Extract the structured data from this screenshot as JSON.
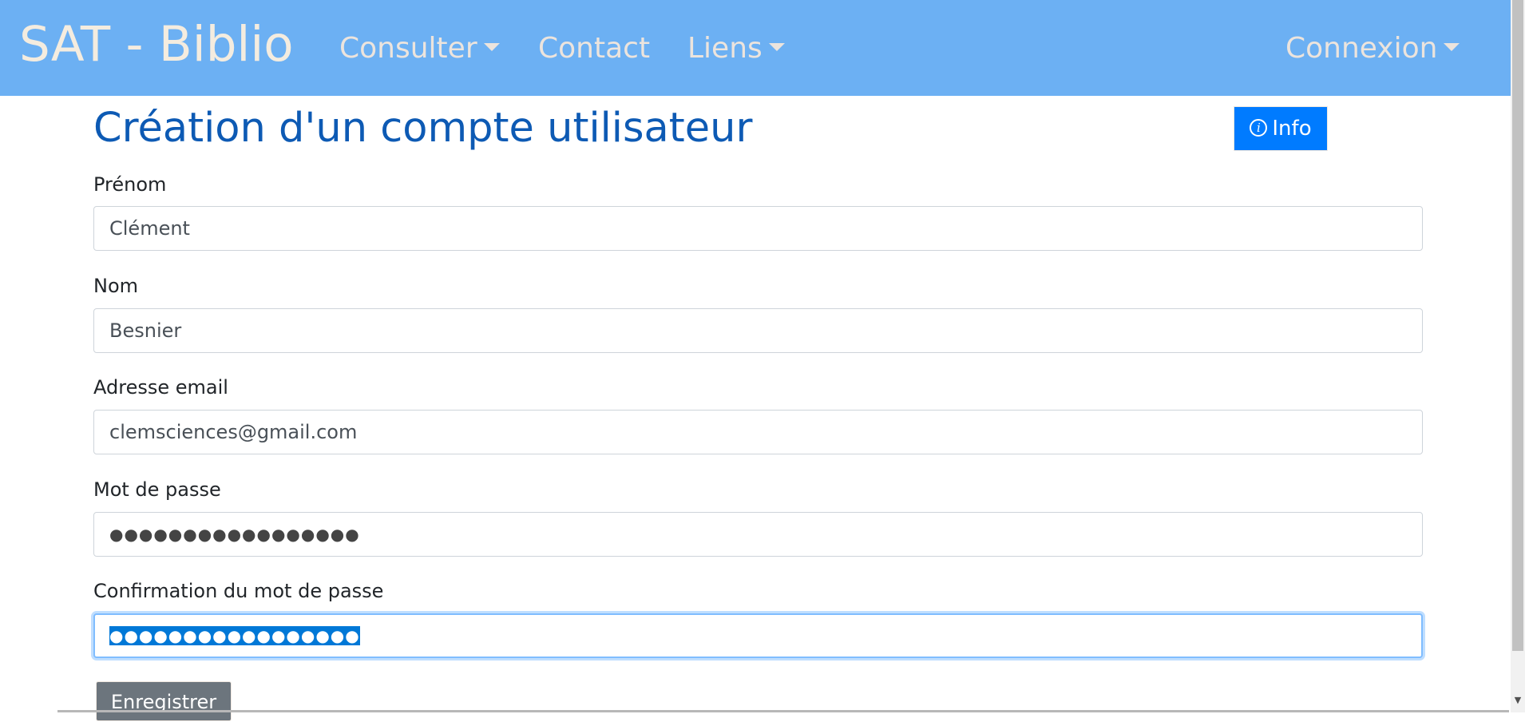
{
  "navbar": {
    "brand": "SAT - Biblio",
    "items": [
      {
        "label": "Consulter",
        "dropdown": true
      },
      {
        "label": "Contact",
        "dropdown": false
      },
      {
        "label": "Liens",
        "dropdown": true
      }
    ],
    "login": {
      "label": "Connexion",
      "dropdown": true
    }
  },
  "form": {
    "title": "Création d'un compte utilisateur",
    "info_button": {
      "label": "Info",
      "icon": "info-icon"
    },
    "fields": [
      {
        "label": "Prénom",
        "value": "Clément",
        "type": "text"
      },
      {
        "label": "Nom",
        "value": "Besnier",
        "type": "text"
      },
      {
        "label": "Adresse email",
        "value": "clemsciences@gmail.com",
        "type": "email"
      },
      {
        "label": "Mot de passe",
        "value": "●●●●●●●●●●●●●●●●●",
        "type": "password"
      },
      {
        "label": "Confirmation du mot de passe",
        "value": "●●●●●●●●●●●●●●●●●",
        "type": "password",
        "focused": true,
        "selected": true
      }
    ],
    "submit_label": "Enregistrer"
  },
  "colors": {
    "navbar_bg": "#6cb0f3",
    "brand_text": "#f4ecdf",
    "title_text": "#0d5ab4",
    "info_button_bg": "#007bff",
    "submit_button_bg": "#6c757d",
    "selection_bg": "#0078d7"
  }
}
